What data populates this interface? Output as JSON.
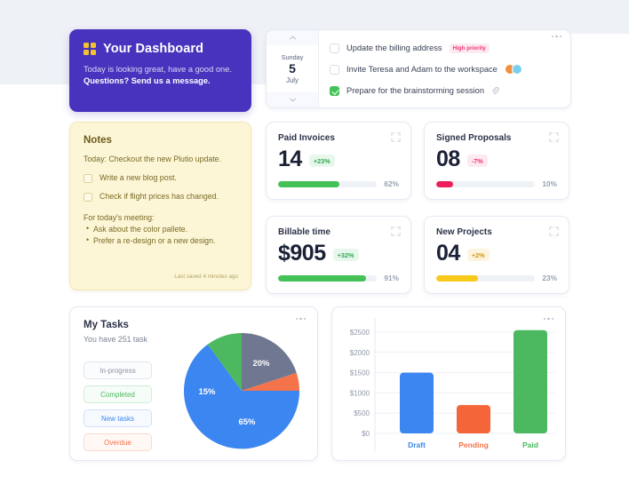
{
  "welcome": {
    "icon": "four-dots-grid-icon",
    "title": "Your Dashboard",
    "line1": "Today is looking great, have a good one.",
    "line2": "Questions? Send us a message.",
    "bg_color": "#4733bd",
    "icon_color": "#f2c230"
  },
  "date_nav": {
    "up_icon": "chevron-up-icon",
    "down_icon": "chevron-down-icon",
    "weekday": "Sunday",
    "day": "5",
    "month": "July"
  },
  "tasks": {
    "menu_icon": "more-options-icon",
    "items": [
      {
        "label": "Update the billing address",
        "checked": false,
        "badge": "High priority",
        "badge_color": "#f4356c"
      },
      {
        "label": "Invite Teresa and Adam to the workspace",
        "checked": false,
        "avatars": 2
      },
      {
        "label": "Prepare for the brainstorming session",
        "checked": true,
        "attachment_icon": "paperclip-icon"
      }
    ]
  },
  "notes": {
    "title": "Notes",
    "intro": "Today: Checkout the new Plutio update.",
    "checklist": [
      {
        "label": "Write a new blog post.",
        "checked": false
      },
      {
        "label": "Check if flight prices has changed.",
        "checked": false
      }
    ],
    "meeting_header": "For today's meeting:",
    "bullets": [
      "Ask about the color pallete.",
      "Prefer a re-design or a new design."
    ],
    "saved_text": "Last saved 4 minutes ago",
    "bg_color": "#fcf6d6"
  },
  "stats": [
    {
      "title": "Paid Invoices",
      "value": "14",
      "delta": "+23%",
      "delta_type": "green",
      "progress": 62,
      "progress_label": "62%",
      "bar_color": "#44c257",
      "expand_icon": "expand-icon"
    },
    {
      "title": "Signed Proposals",
      "value": "08",
      "delta": "-7%",
      "delta_type": "red",
      "progress": 10,
      "progress_label": "10%",
      "bar_color": "#ec1f5d",
      "expand_icon": "expand-icon"
    },
    {
      "title": "Billable time",
      "value": "$905",
      "delta": "+32%",
      "delta_type": "green",
      "progress": 91,
      "progress_label": "91%",
      "bar_color": "#44c257",
      "expand_icon": "expand-icon"
    },
    {
      "title": "New Projects",
      "value": "04",
      "delta": "+2%",
      "delta_type": "yellow",
      "progress": 23,
      "progress_label": "23%",
      "bar_color": "#f7c91b",
      "expand_icon": "expand-icon"
    }
  ],
  "my_tasks": {
    "title": "My Tasks",
    "subtitle": "You have 251 task",
    "menu_icon": "more-options-icon",
    "chips": [
      {
        "label": "In-progress",
        "style": "c-gray"
      },
      {
        "label": "Completed",
        "style": "c-green"
      },
      {
        "label": "New tasks",
        "style": "c-blue"
      },
      {
        "label": "Overdue",
        "style": "c-orange"
      }
    ]
  },
  "bar_card": {
    "menu_icon": "more-options-icon"
  },
  "chart_data": [
    {
      "type": "pie",
      "title": "My Tasks",
      "labels": [
        "In-progress",
        "New tasks",
        "Completed",
        "Overdue"
      ],
      "values": [
        20,
        65,
        15,
        5
      ],
      "display_labels": [
        "20%",
        "65%",
        "15%",
        ""
      ],
      "colors": [
        "#6f7890",
        "#3b86f0",
        "#4cb860",
        "#f4734a"
      ],
      "legend_position": "left"
    },
    {
      "type": "bar",
      "categories": [
        "Draft",
        "Pending",
        "Paid"
      ],
      "values": [
        1500,
        700,
        2550
      ],
      "colors": [
        "#3b86f0",
        "#f4653a",
        "#4cb860"
      ],
      "ylabel": "",
      "xlabel": "",
      "ylim": [
        0,
        2800
      ],
      "yticks": [
        0,
        500,
        1000,
        1500,
        2000,
        2500
      ],
      "ytick_labels": [
        "$0",
        "$500",
        "$1000",
        "$1500",
        "$2000",
        "$2500"
      ],
      "grid": true,
      "tick_label_colors": [
        "#3b86f0",
        "#f4734a",
        "#4cb860"
      ]
    }
  ]
}
